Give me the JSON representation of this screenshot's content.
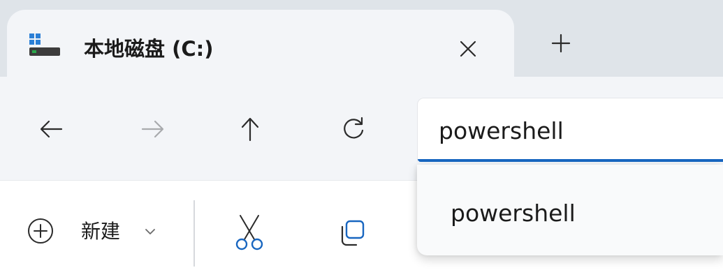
{
  "tab": {
    "title": "本地磁盘 (C:)",
    "icon": "drive-icon",
    "close_icon": "close-icon",
    "new_tab_icon": "plus-icon"
  },
  "nav": {
    "back_icon": "arrow-left-icon",
    "forward_icon": "arrow-right-icon",
    "up_icon": "arrow-up-icon",
    "refresh_icon": "refresh-icon"
  },
  "address": {
    "value": "powershell"
  },
  "suggestions": [
    {
      "label": "powershell"
    }
  ],
  "commandbar": {
    "new_label": "新建",
    "cut_icon": "scissors-icon",
    "copy_icon": "copy-icon"
  },
  "colors": {
    "accent": "#1866c0",
    "tabstrip": "#dfe4e9",
    "toolbar": "#f3f5f8",
    "drive_green": "#2aa84a",
    "drive_blue": "#2b7fd6"
  }
}
